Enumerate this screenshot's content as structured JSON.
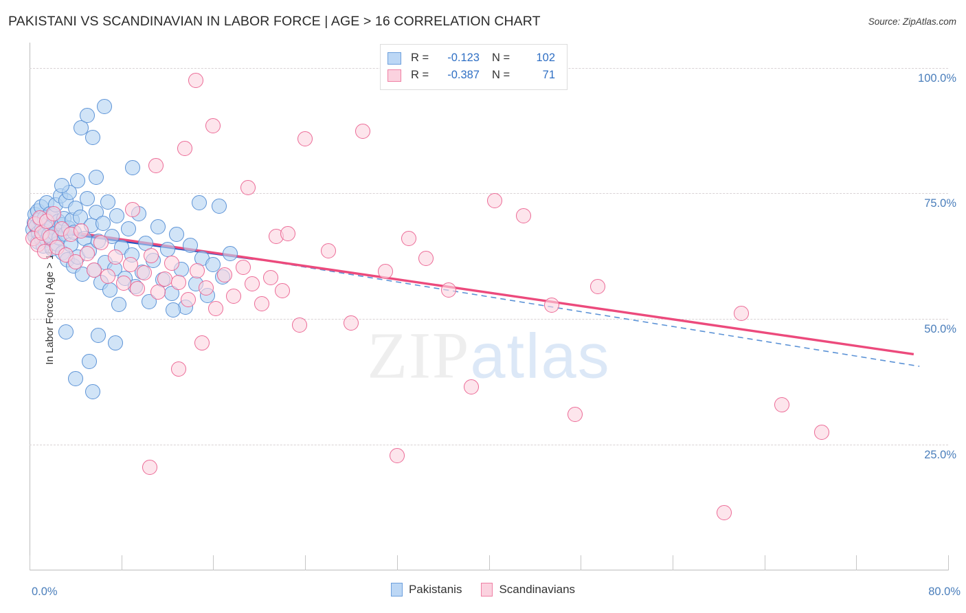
{
  "header": {
    "title": "PAKISTANI VS SCANDINAVIAN IN LABOR FORCE | AGE > 16 CORRELATION CHART",
    "source": "Source: ZipAtlas.com"
  },
  "watermark": {
    "part1": "ZIP",
    "part2": "atlas"
  },
  "stats": {
    "rows": [
      {
        "series": "Pakistanis",
        "r_label": "R =",
        "r_value": "-0.123",
        "n_label": "N =",
        "n_value": "102",
        "color": "#bcd7f5"
      },
      {
        "series": "Scandinavians",
        "r_label": "R =",
        "r_value": "-0.387",
        "n_label": "N =",
        "n_value": "71",
        "color": "#fbd2df"
      }
    ]
  },
  "legend": {
    "items": [
      {
        "label": "Pakistanis",
        "color": "#bcd7f5"
      },
      {
        "label": "Scandinavians",
        "color": "#fbd2df"
      }
    ]
  },
  "axes": {
    "y_title": "In Labor Force | Age > 16",
    "y_ticks": [
      "100.0%",
      "75.0%",
      "50.0%",
      "25.0%"
    ],
    "x_min_label": "0.0%",
    "x_max_label": "80.0%"
  },
  "chart_data": {
    "type": "scatter",
    "title": "PAKISTANI VS SCANDINAVIAN IN LABOR FORCE | AGE > 16 CORRELATION CHART",
    "xlabel": "",
    "ylabel": "In Labor Force | Age > 16",
    "xlim": [
      0,
      80
    ],
    "ylim": [
      0,
      105
    ],
    "x_ticks": [
      0,
      8,
      16,
      24,
      32,
      40,
      48,
      56,
      64,
      72,
      80
    ],
    "y_ticks": [
      25,
      50,
      75,
      100
    ],
    "grid": "horizontal-dashed",
    "legend_position": "bottom-center",
    "series": [
      {
        "name": "Pakistanis",
        "color": "#bcd7f5",
        "edge_color": "#5b92d6",
        "r": -0.123,
        "n": 102,
        "trend": {
          "x0": 0.0,
          "y0": 68.0,
          "x1": 19.5,
          "y1": 62.0,
          "style": "solid",
          "color": "#1f57c4"
        },
        "trend_extension": {
          "x0": 19.5,
          "y0": 62.0,
          "x1": 77.5,
          "y1": 40.6,
          "style": "dashed",
          "color": "#5b92d6"
        },
        "points": [
          [
            0.3,
            67.8
          ],
          [
            0.4,
            69.2
          ],
          [
            0.5,
            66.4
          ],
          [
            0.5,
            70.8
          ],
          [
            0.6,
            68.5
          ],
          [
            0.7,
            65.3
          ],
          [
            0.7,
            71.5
          ],
          [
            0.8,
            67.1
          ],
          [
            0.9,
            69.8
          ],
          [
            1.0,
            66.0
          ],
          [
            1.0,
            72.3
          ],
          [
            1.1,
            68.0
          ],
          [
            1.2,
            64.5
          ],
          [
            1.3,
            70.1
          ],
          [
            1.4,
            67.4
          ],
          [
            1.5,
            73.1
          ],
          [
            1.5,
            65.8
          ],
          [
            1.6,
            69.0
          ],
          [
            1.7,
            66.7
          ],
          [
            1.8,
            71.0
          ],
          [
            1.9,
            68.3
          ],
          [
            2.0,
            64.0
          ],
          [
            2.1,
            70.5
          ],
          [
            2.2,
            67.0
          ],
          [
            2.3,
            72.8
          ],
          [
            2.4,
            65.0
          ],
          [
            2.5,
            69.5
          ],
          [
            2.6,
            66.2
          ],
          [
            2.7,
            74.5
          ],
          [
            2.8,
            68.8
          ],
          [
            2.9,
            63.2
          ],
          [
            3.0,
            70.0
          ],
          [
            3.1,
            66.9
          ],
          [
            3.2,
            73.6
          ],
          [
            3.3,
            61.8
          ],
          [
            3.4,
            68.1
          ],
          [
            3.5,
            75.2
          ],
          [
            3.6,
            64.8
          ],
          [
            3.7,
            69.7
          ],
          [
            3.8,
            60.5
          ],
          [
            3.9,
            67.3
          ],
          [
            4.0,
            72.0
          ],
          [
            4.2,
            62.4
          ],
          [
            4.4,
            70.3
          ],
          [
            4.6,
            58.9
          ],
          [
            4.8,
            66.1
          ],
          [
            5.0,
            74.0
          ],
          [
            5.2,
            63.6
          ],
          [
            5.4,
            68.7
          ],
          [
            5.6,
            59.7
          ],
          [
            5.8,
            71.2
          ],
          [
            6.0,
            65.5
          ],
          [
            6.2,
            57.3
          ],
          [
            6.4,
            69.1
          ],
          [
            6.6,
            61.2
          ],
          [
            6.8,
            73.3
          ],
          [
            7.0,
            55.8
          ],
          [
            7.2,
            66.5
          ],
          [
            7.4,
            60.0
          ],
          [
            7.6,
            70.6
          ],
          [
            7.8,
            52.9
          ],
          [
            8.0,
            64.3
          ],
          [
            8.3,
            58.1
          ],
          [
            8.6,
            67.9
          ],
          [
            8.9,
            62.7
          ],
          [
            9.2,
            56.4
          ],
          [
            9.5,
            70.9
          ],
          [
            9.8,
            59.3
          ],
          [
            10.1,
            65.1
          ],
          [
            10.4,
            53.5
          ],
          [
            10.8,
            61.6
          ],
          [
            11.2,
            68.4
          ],
          [
            11.6,
            57.8
          ],
          [
            12.0,
            63.9
          ],
          [
            12.4,
            55.1
          ],
          [
            12.8,
            66.8
          ],
          [
            13.2,
            59.9
          ],
          [
            13.6,
            52.3
          ],
          [
            14.0,
            64.6
          ],
          [
            14.5,
            57.0
          ],
          [
            15.0,
            62.1
          ],
          [
            15.5,
            54.7
          ],
          [
            16.0,
            60.8
          ],
          [
            16.8,
            58.4
          ],
          [
            17.5,
            63.0
          ],
          [
            4.5,
            88.0
          ],
          [
            5.0,
            90.5
          ],
          [
            5.5,
            86.2
          ],
          [
            6.5,
            92.3
          ],
          [
            9.0,
            80.1
          ],
          [
            4.2,
            77.5
          ],
          [
            5.8,
            78.2
          ],
          [
            2.8,
            76.5
          ],
          [
            6.0,
            46.8
          ],
          [
            3.2,
            47.5
          ],
          [
            5.2,
            41.5
          ],
          [
            4.0,
            38.2
          ],
          [
            5.5,
            35.6
          ],
          [
            7.5,
            45.3
          ],
          [
            12.5,
            51.8
          ],
          [
            14.8,
            73.1
          ],
          [
            16.5,
            72.4
          ]
        ]
      },
      {
        "name": "Scandinavians",
        "color": "#fbd2df",
        "edge_color": "#ec6a96",
        "r": -0.387,
        "n": 71,
        "trend": {
          "x0": 0.0,
          "y0": 68.5,
          "x1": 77.0,
          "y1": 43.0,
          "style": "solid",
          "color": "#ec4a7c"
        },
        "points": [
          [
            0.3,
            66.0
          ],
          [
            0.5,
            68.9
          ],
          [
            0.7,
            64.8
          ],
          [
            0.9,
            70.2
          ],
          [
            1.1,
            67.1
          ],
          [
            1.3,
            63.5
          ],
          [
            1.5,
            69.4
          ],
          [
            1.8,
            66.3
          ],
          [
            2.1,
            71.0
          ],
          [
            2.4,
            64.2
          ],
          [
            2.8,
            68.0
          ],
          [
            3.2,
            62.8
          ],
          [
            3.6,
            66.9
          ],
          [
            4.0,
            61.4
          ],
          [
            4.5,
            67.6
          ],
          [
            5.0,
            63.0
          ],
          [
            5.6,
            59.8
          ],
          [
            6.2,
            65.2
          ],
          [
            6.8,
            58.5
          ],
          [
            7.5,
            62.3
          ],
          [
            8.2,
            57.1
          ],
          [
            8.8,
            60.9
          ],
          [
            9.4,
            56.0
          ],
          [
            10.0,
            59.2
          ],
          [
            10.6,
            62.6
          ],
          [
            11.2,
            55.4
          ],
          [
            11.8,
            58.0
          ],
          [
            12.4,
            61.1
          ],
          [
            13.0,
            57.3
          ],
          [
            13.8,
            53.8
          ],
          [
            14.6,
            59.6
          ],
          [
            15.4,
            56.2
          ],
          [
            16.2,
            52.1
          ],
          [
            17.0,
            58.8
          ],
          [
            17.8,
            54.5
          ],
          [
            18.6,
            60.3
          ],
          [
            19.4,
            57.0
          ],
          [
            20.2,
            53.0
          ],
          [
            21.0,
            58.2
          ],
          [
            22.0,
            55.6
          ],
          [
            9.0,
            71.8
          ],
          [
            11.0,
            80.5
          ],
          [
            13.5,
            84.0
          ],
          [
            16.0,
            88.5
          ],
          [
            19.0,
            76.2
          ],
          [
            21.5,
            66.5
          ],
          [
            22.5,
            67.0
          ],
          [
            24.0,
            85.8
          ],
          [
            26.0,
            63.6
          ],
          [
            28.0,
            49.2
          ],
          [
            29.0,
            87.3
          ],
          [
            31.0,
            59.5
          ],
          [
            33.0,
            66.0
          ],
          [
            34.5,
            62.1
          ],
          [
            36.5,
            55.8
          ],
          [
            38.5,
            36.5
          ],
          [
            40.5,
            73.5
          ],
          [
            43.0,
            70.5
          ],
          [
            45.5,
            52.8
          ],
          [
            47.5,
            31.0
          ],
          [
            49.5,
            56.5
          ],
          [
            14.5,
            97.5
          ],
          [
            15.0,
            45.2
          ],
          [
            13.0,
            40.0
          ],
          [
            10.5,
            20.5
          ],
          [
            32.0,
            22.9
          ],
          [
            62.0,
            51.2
          ],
          [
            65.5,
            33.0
          ],
          [
            69.0,
            27.5
          ],
          [
            60.5,
            11.5
          ],
          [
            23.5,
            48.8
          ]
        ]
      }
    ]
  }
}
